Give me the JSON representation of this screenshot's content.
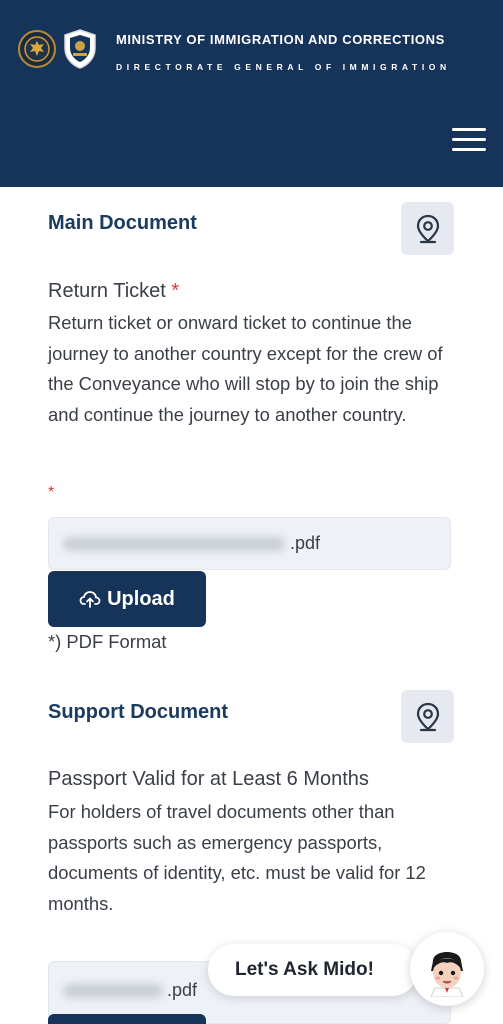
{
  "header": {
    "title": "MINISTRY OF IMMIGRATION AND CORRECTIONS",
    "subtitle": "DIRECTORATE GENERAL OF IMMIGRATION",
    "menu_icon": "hamburger-icon",
    "background": "#16335a"
  },
  "main_section": {
    "title": "Main Document",
    "location_icon": "location-pin-icon",
    "document": {
      "name": "Return Ticket",
      "required_mark": "*",
      "description": "Return ticket or onward ticket to continue the journey to another country except for the crew of the Conveyance who will stop by to join the ship and continue the journey to another country.",
      "file_required_mark": "*",
      "file_ext": ".pdf",
      "upload_label": "Upload",
      "upload_icon": "cloud-upload-icon",
      "format_note": "*) PDF Format"
    }
  },
  "support_section": {
    "title": "Support Document",
    "location_icon": "location-pin-icon",
    "document": {
      "name": "Passport Valid for at Least 6 Months",
      "description": "For holders of travel documents other than passports such as emergency passports, documents of identity, etc. must be valid for 12 months.",
      "file_ext": ".pdf"
    }
  },
  "chat": {
    "label": "Let's Ask Mido!",
    "avatar_icon": "mido-avatar-icon"
  },
  "colors": {
    "primary": "#16335a",
    "heading": "#1c3b60",
    "required": "#d33a3a"
  }
}
